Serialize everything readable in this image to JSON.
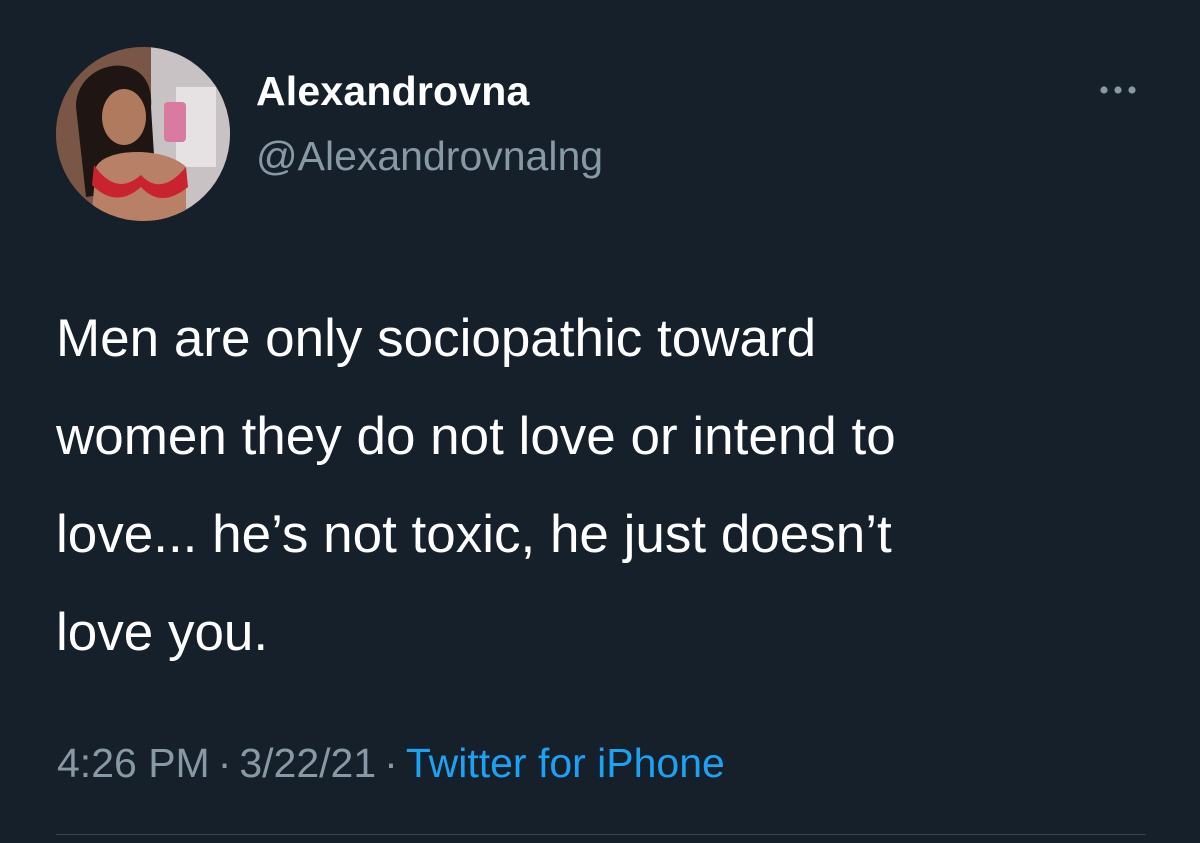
{
  "user": {
    "display_name": "Alexandrovna",
    "handle": "@Alexandrovnalng"
  },
  "tweet": {
    "text": "Men are only sociopathic toward\nwomen they do not love or intend to\nlove... he’s not toxic, he just doesn’t\nlove you."
  },
  "meta": {
    "time": "4:26 PM",
    "separator": "·",
    "date": "3/22/21",
    "source": "Twitter for iPhone"
  },
  "icons": {
    "more": "more-horizontal-icon"
  },
  "colors": {
    "background": "#15202b",
    "primary_text": "#ffffff",
    "secondary_text": "#8899a6",
    "link": "#1da1f2",
    "divider": "#38444d"
  }
}
